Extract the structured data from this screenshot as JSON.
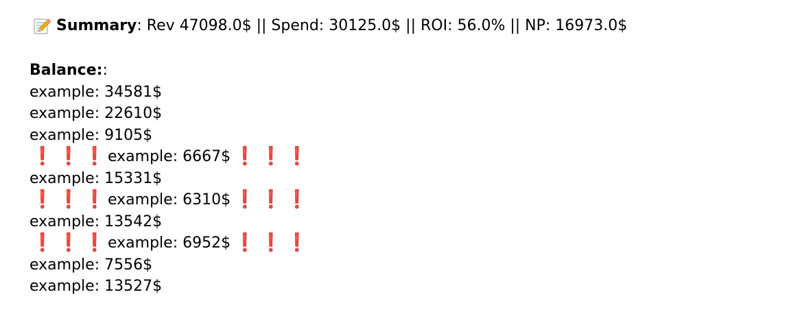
{
  "summary": {
    "icon": "memo-icon",
    "title": "Summary",
    "separator": ": ",
    "text": "Rev 47098.0$ || Spend: 30125.0$ || ROI: 56.0% || NP: 16973.0$"
  },
  "balance": {
    "title": "Balance:",
    "title_suffix": ":",
    "alert_glyph": "❗",
    "alert_color": "#d40000",
    "rows": [
      {
        "text": "example: 34581$",
        "flagged": false
      },
      {
        "text": "example: 22610$",
        "flagged": false
      },
      {
        "text": "example: 9105$",
        "flagged": false
      },
      {
        "text": "example: 6667$",
        "flagged": true
      },
      {
        "text": "example: 15331$",
        "flagged": false
      },
      {
        "text": "example: 6310$",
        "flagged": true
      },
      {
        "text": "example: 13542$",
        "flagged": false
      },
      {
        "text": "example: 6952$",
        "flagged": true
      },
      {
        "text": "example: 7556$",
        "flagged": false
      },
      {
        "text": "example: 13527$",
        "flagged": false
      }
    ]
  }
}
